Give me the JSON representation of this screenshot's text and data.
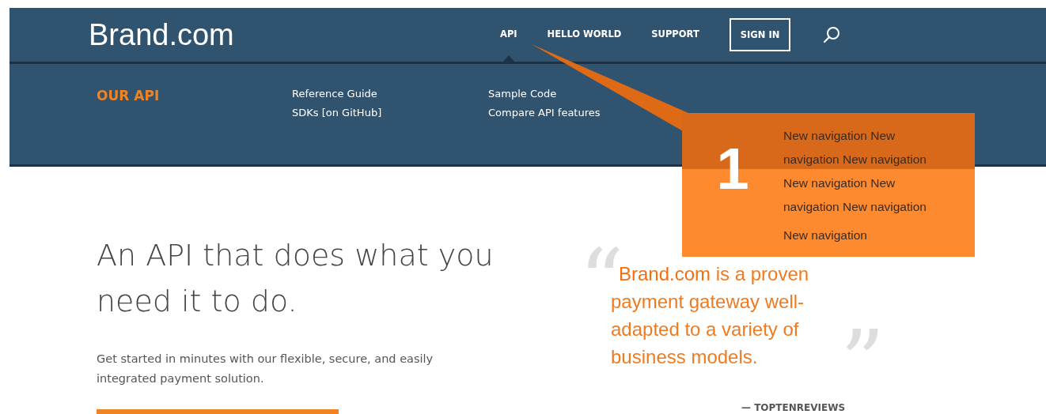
{
  "header": {
    "brand": "Brand.com",
    "nav": [
      {
        "label": "API",
        "selected": true
      },
      {
        "label": "HELLO WORLD",
        "selected": false
      },
      {
        "label": "SUPPORT",
        "selected": false
      }
    ],
    "sign_in": "SIGN IN"
  },
  "submenu": {
    "title": "OUR API",
    "columns": [
      [
        "Reference Guide",
        "SDKs [on GitHub]"
      ],
      [
        "Sample Code",
        "Compare API features"
      ]
    ]
  },
  "hero": {
    "heading": "An API that does what you need it to do.",
    "text": "Get started in minutes with our flexible, secure, and easily integrated payment solution."
  },
  "quote": {
    "open_mark": "“",
    "brand": "Brand.com",
    "text": "is a proven payment gateway well-adapted to a variety of business models.",
    "close_mark": "”",
    "source": "— TOPTENREVIEWS"
  },
  "callout": {
    "number": "1",
    "notes": [
      "New navigation New navigation New navigation New navigation New navigation New navigation",
      "New navigation"
    ]
  }
}
